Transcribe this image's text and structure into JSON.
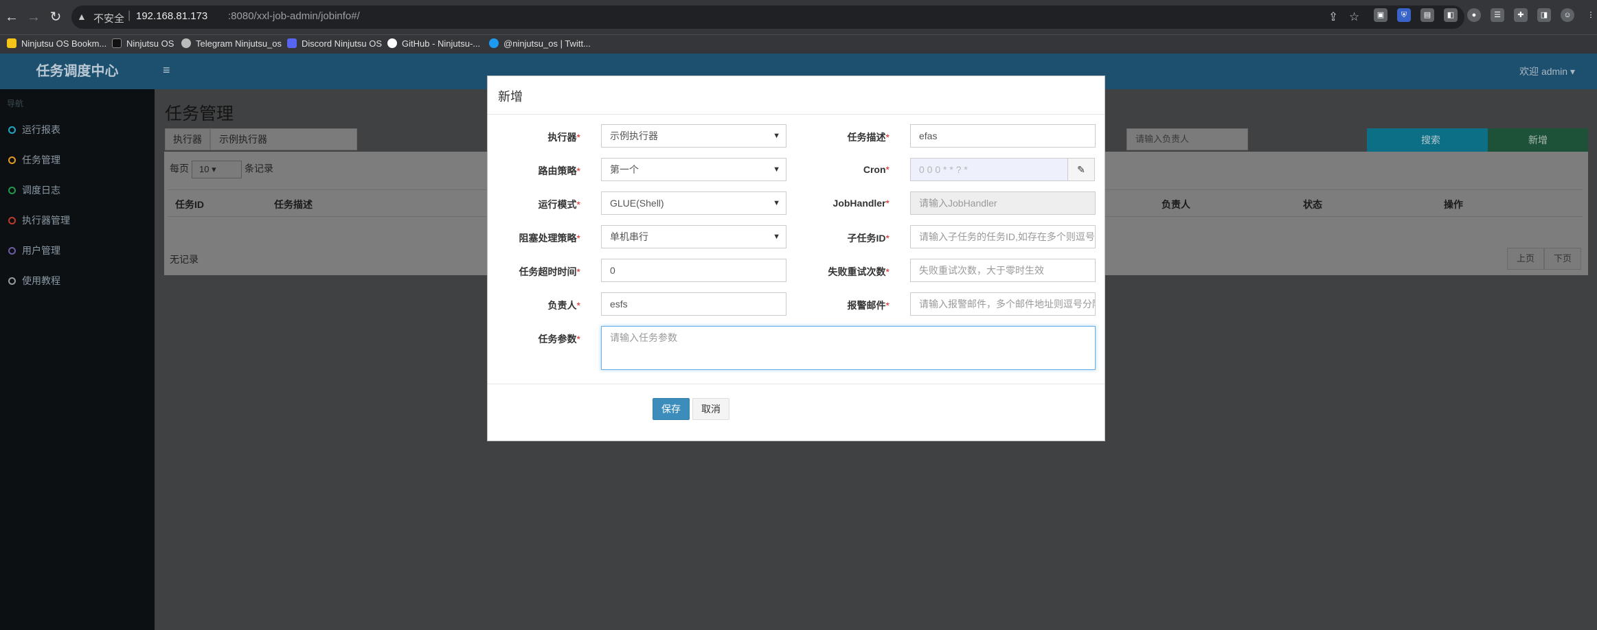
{
  "browser": {
    "url_warning": "不安全",
    "url_host": "192.168.81.173",
    "url_rest": ":8080/xxl-job-admin/jobinfo#/",
    "bookmarks": [
      {
        "label": "Ninjutsu OS Bookm...",
        "color": "#f5c518"
      },
      {
        "label": "Ninjutsu OS",
        "color": "#222222"
      },
      {
        "label": "Telegram Ninjutsu_os",
        "color": "#bbbbbb"
      },
      {
        "label": "Discord Ninjutsu OS",
        "color": "#5865f2"
      },
      {
        "label": "GitHub - Ninjutsu-...",
        "color": "#ffffff"
      },
      {
        "label": "@ninjutsu_os | Twitt...",
        "color": "#1d9bf0"
      }
    ]
  },
  "app": {
    "logo": "任务调度中心",
    "welcome": "欢迎 admin ▾",
    "sidebar": {
      "heading": "导航",
      "items": [
        {
          "label": "运行报表",
          "color": "#1fa7c8"
        },
        {
          "label": "任务管理",
          "color": "#e39a1f"
        },
        {
          "label": "调度日志",
          "color": "#1f9a4f"
        },
        {
          "label": "执行器管理",
          "color": "#c0392b"
        },
        {
          "label": "用户管理",
          "color": "#6b5ca5"
        },
        {
          "label": "使用教程",
          "color": "#9a9a9a"
        }
      ]
    },
    "page_title": "任务管理",
    "filter": {
      "label": "执行器",
      "value": "示例执行器",
      "owner_placeholder": "请输入负责人"
    },
    "search_label": "搜索",
    "add_label": "新增",
    "table": {
      "per_page_prefix": "每页",
      "per_page_value": "10",
      "per_page_suffix": "条记录",
      "headers": [
        "任务ID",
        "任务描述",
        "负责人",
        "状态",
        "操作"
      ],
      "no_data": "无记录",
      "prev": "上页",
      "next": "下页"
    }
  },
  "modal": {
    "title": "新增",
    "fields": {
      "executor": {
        "label": "执行器",
        "value": "示例执行器"
      },
      "desc": {
        "label": "任务描述",
        "value": "efas"
      },
      "route": {
        "label": "路由策略",
        "value": "第一个"
      },
      "cron": {
        "label": "Cron",
        "value": "0 0 0 * * ? *"
      },
      "mode": {
        "label": "运行模式",
        "value": "GLUE(Shell)"
      },
      "handler": {
        "label": "JobHandler",
        "placeholder": "请输入JobHandler"
      },
      "block": {
        "label": "阻塞处理策略",
        "value": "单机串行"
      },
      "child": {
        "label": "子任务ID",
        "placeholder": "请输入子任务的任务ID,如存在多个则逗号分隔"
      },
      "timeout": {
        "label": "任务超时时间",
        "value": "0"
      },
      "retry": {
        "label": "失败重试次数",
        "placeholder": "失败重试次数，大于零时生效"
      },
      "owner": {
        "label": "负责人",
        "value": "esfs"
      },
      "email": {
        "label": "报警邮件",
        "placeholder": "请输入报警邮件，多个邮件地址则逗号分隔"
      },
      "params": {
        "label": "任务参数",
        "placeholder": "请输入任务参数"
      }
    },
    "save": "保存",
    "cancel": "取消"
  }
}
